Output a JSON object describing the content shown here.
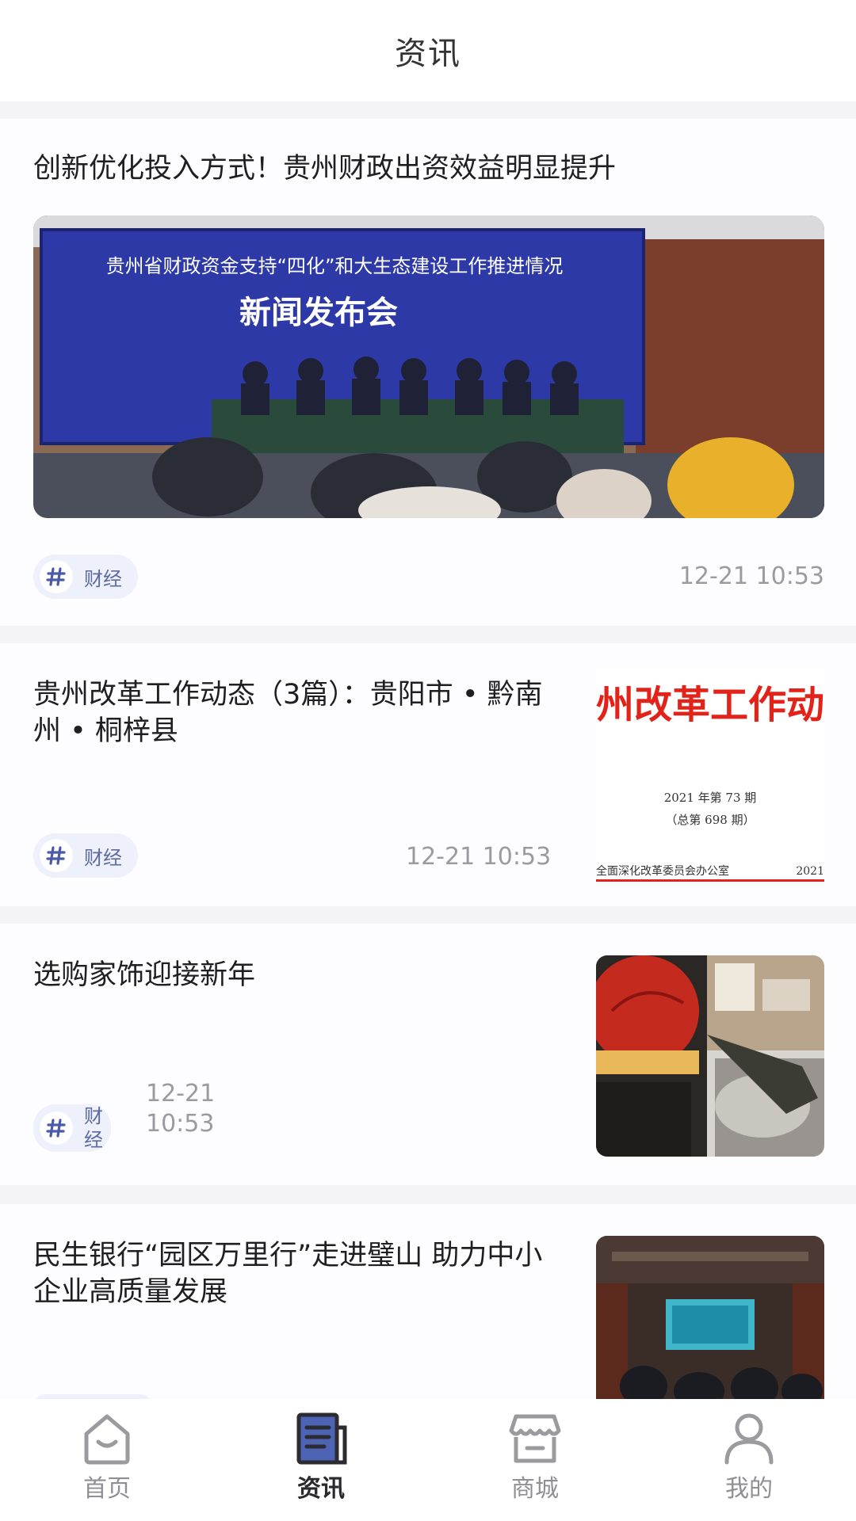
{
  "header": {
    "title": "资讯"
  },
  "articles": [
    {
      "title": "创新优化投入方式！贵州财政出资效益明显提升",
      "tag": "财经",
      "time": "12-21 10:53",
      "image": {
        "banner_line1": "贵州省财政资金支持“四化”和大生态建设工作推进情况",
        "banner_line2": "新闻发布会"
      }
    },
    {
      "title": "贵州改革工作动态（3篇）：贵阳市 • 黔南州 • 桐梓县",
      "tag": "财经",
      "time": "12-21 10:53",
      "image": {
        "headline": "州改革工作动",
        "issue": "2021 年第 73 期",
        "total": "（总第 698 期）",
        "footer_left": "全面深化改革委员会办公室",
        "footer_right": "2021"
      }
    },
    {
      "title": "选购家饰迎接新年",
      "tag_lines": [
        "财",
        "经"
      ],
      "time_lines": [
        "12-21",
        "10:53"
      ]
    },
    {
      "title": "民生银行“园区万里行”走进璧山 助力中小企业高质量发展"
    }
  ],
  "tabbar": {
    "items": [
      {
        "label": "首页",
        "icon": "home-icon",
        "active": false
      },
      {
        "label": "资讯",
        "icon": "news-icon",
        "active": true
      },
      {
        "label": "商城",
        "icon": "store-icon",
        "active": false
      },
      {
        "label": "我的",
        "icon": "user-icon",
        "active": false
      }
    ]
  },
  "colors": {
    "accent": "#4a5aa8",
    "tag_bg": "#eef1fb",
    "muted": "#9a9aa0"
  }
}
